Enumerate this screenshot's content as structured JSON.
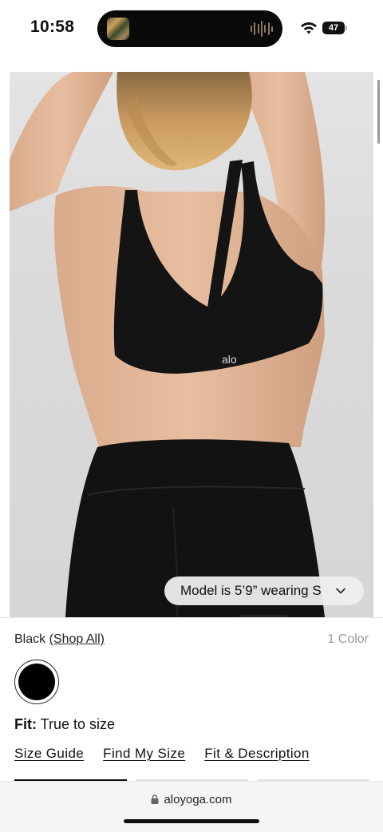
{
  "status_bar": {
    "time": "10:58",
    "battery": "47"
  },
  "product": {
    "image_alt": "Model wearing black sports bra and leggings, back view",
    "model_info": "Model is 5’9” wearing S",
    "selected_color": "Black",
    "shop_all_label": "(Shop All)",
    "color_count": "1 Color",
    "swatch_color": "#000000",
    "fit_label": "Fit:",
    "fit_value": "True to size",
    "links": {
      "size_guide": "Size Guide",
      "find_my_size": "Find My Size",
      "fit_description": "Fit & Description"
    }
  },
  "browser": {
    "url": "aloyoga.com"
  }
}
